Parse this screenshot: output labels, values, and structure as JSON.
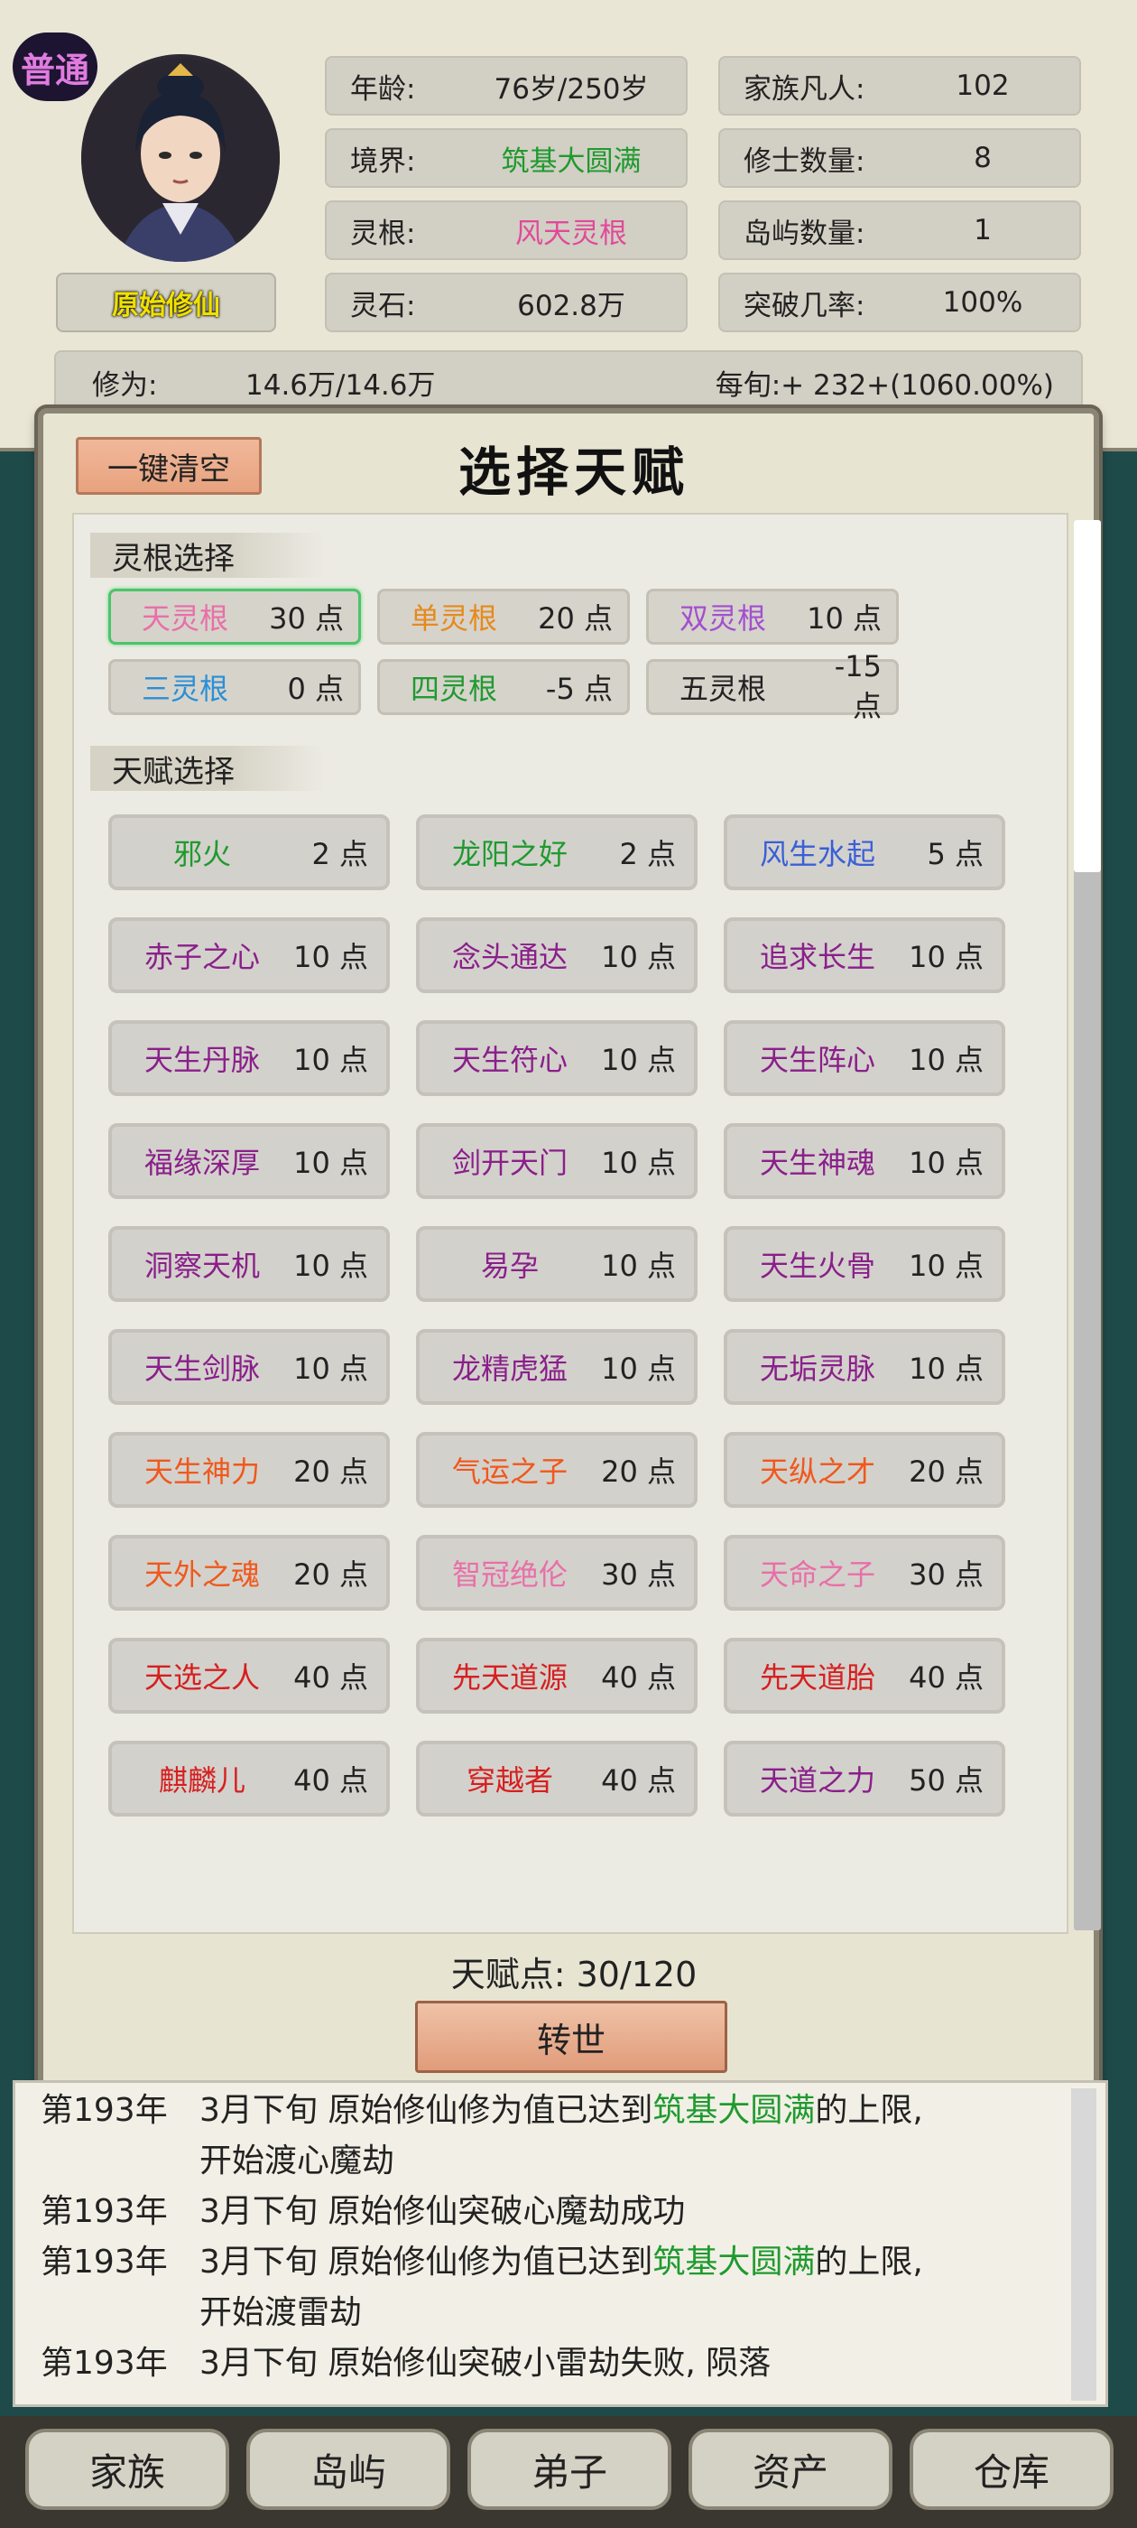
{
  "header": {
    "badge": "普通",
    "character_name": "原始修仙",
    "stats_left": [
      {
        "key": "年龄:",
        "value": "76岁/250岁",
        "color": "#222222"
      },
      {
        "key": "境界:",
        "value": "筑基大圆满",
        "color": "#1f9a2f"
      },
      {
        "key": "灵根:",
        "value": "风天灵根",
        "color": "#e04a9a"
      },
      {
        "key": "灵石:",
        "value": "602.8万",
        "color": "#222222"
      }
    ],
    "stats_right": [
      {
        "key": "家族凡人:",
        "value": "102"
      },
      {
        "key": "修士数量:",
        "value": "8"
      },
      {
        "key": "岛屿数量:",
        "value": "1"
      },
      {
        "key": "突破几率:",
        "value": "100%"
      }
    ],
    "xiuwei_label": "修为:",
    "xiuwei_value": "14.6万/14.6万",
    "per_period": "每旬:+ 232+(1060.00%)"
  },
  "panel": {
    "clear_button": "一键清空",
    "title": "选择天赋",
    "root_section_label": "灵根选择",
    "roots": [
      {
        "name": "天灵根",
        "points": "30 点",
        "color": "#e86fa8",
        "selected": true
      },
      {
        "name": "单灵根",
        "points": "20 点",
        "color": "#e68a1c",
        "selected": false
      },
      {
        "name": "双灵根",
        "points": "10 点",
        "color": "#a24fd0",
        "selected": false
      },
      {
        "name": "三灵根",
        "points": "0 点",
        "color": "#2a8fd6",
        "selected": false
      },
      {
        "name": "四灵根",
        "points": "-5 点",
        "color": "#1f9a2f",
        "selected": false
      },
      {
        "name": "五灵根",
        "points": "-15 点",
        "color": "#222222",
        "selected": false
      }
    ],
    "talent_section_label": "天赋选择",
    "talents": [
      {
        "name": "邪火",
        "points": "2 点",
        "color": "#1f9a2f"
      },
      {
        "name": "龙阳之好",
        "points": "2 点",
        "color": "#1f9a2f"
      },
      {
        "name": "风生水起",
        "points": "5 点",
        "color": "#3a5fd6"
      },
      {
        "name": "赤子之心",
        "points": "10 点",
        "color": "#8a1f8a"
      },
      {
        "name": "念头通达",
        "points": "10 点",
        "color": "#8a1f8a"
      },
      {
        "name": "追求长生",
        "points": "10 点",
        "color": "#8a1f8a"
      },
      {
        "name": "天生丹脉",
        "points": "10 点",
        "color": "#8a1f8a"
      },
      {
        "name": "天生符心",
        "points": "10 点",
        "color": "#8a1f8a"
      },
      {
        "name": "天生阵心",
        "points": "10 点",
        "color": "#8a1f8a"
      },
      {
        "name": "福缘深厚",
        "points": "10 点",
        "color": "#8a1f8a"
      },
      {
        "name": "剑开天门",
        "points": "10 点",
        "color": "#8a1f8a"
      },
      {
        "name": "天生神魂",
        "points": "10 点",
        "color": "#8a1f8a"
      },
      {
        "name": "洞察天机",
        "points": "10 点",
        "color": "#8a1f8a"
      },
      {
        "name": "易孕",
        "points": "10 点",
        "color": "#8a1f8a"
      },
      {
        "name": "天生火骨",
        "points": "10 点",
        "color": "#8a1f8a"
      },
      {
        "name": "天生剑脉",
        "points": "10 点",
        "color": "#8a1f8a"
      },
      {
        "name": "龙精虎猛",
        "points": "10 点",
        "color": "#8a1f8a"
      },
      {
        "name": "无垢灵脉",
        "points": "10 点",
        "color": "#8a1f8a"
      },
      {
        "name": "天生神力",
        "points": "20 点",
        "color": "#f0581c"
      },
      {
        "name": "气运之子",
        "points": "20 点",
        "color": "#f0581c"
      },
      {
        "name": "天纵之才",
        "points": "20 点",
        "color": "#f0581c"
      },
      {
        "name": "天外之魂",
        "points": "20 点",
        "color": "#f0581c"
      },
      {
        "name": "智冠绝伦",
        "points": "30 点",
        "color": "#e86fa8"
      },
      {
        "name": "天命之子",
        "points": "30 点",
        "color": "#e86fa8"
      },
      {
        "name": "天选之人",
        "points": "40 点",
        "color": "#d61f1f"
      },
      {
        "name": "先天道源",
        "points": "40 点",
        "color": "#d61f1f"
      },
      {
        "name": "先天道胎",
        "points": "40 点",
        "color": "#d61f1f"
      },
      {
        "name": "麒麟儿",
        "points": "40 点",
        "color": "#d61f1f"
      },
      {
        "name": "穿越者",
        "points": "40 点",
        "color": "#d61f1f"
      },
      {
        "name": "天道之力",
        "points": "50 点",
        "color": "#8a1f8a"
      }
    ],
    "points_text": "天赋点:  30/120",
    "rebirth_button": "转世"
  },
  "log": [
    {
      "year": "第193年",
      "pre": "3月下旬 原始修仙修为值已达到",
      "highlight": "筑基大圆满",
      "post": "的上限,"
    },
    {
      "year": "",
      "pre": "开始渡心魔劫",
      "highlight": "",
      "post": ""
    },
    {
      "year": "第193年",
      "pre": "3月下旬 原始修仙突破心魔劫成功",
      "highlight": "",
      "post": ""
    },
    {
      "year": "第193年",
      "pre": "3月下旬 原始修仙修为值已达到",
      "highlight": "筑基大圆满",
      "post": "的上限,"
    },
    {
      "year": "",
      "pre": "开始渡雷劫",
      "highlight": "",
      "post": ""
    },
    {
      "year": "第193年",
      "pre": "3月下旬 原始修仙突破小雷劫失败, 陨落",
      "highlight": "",
      "post": ""
    }
  ],
  "nav": [
    "家族",
    "岛屿",
    "弟子",
    "资产",
    "仓库"
  ]
}
